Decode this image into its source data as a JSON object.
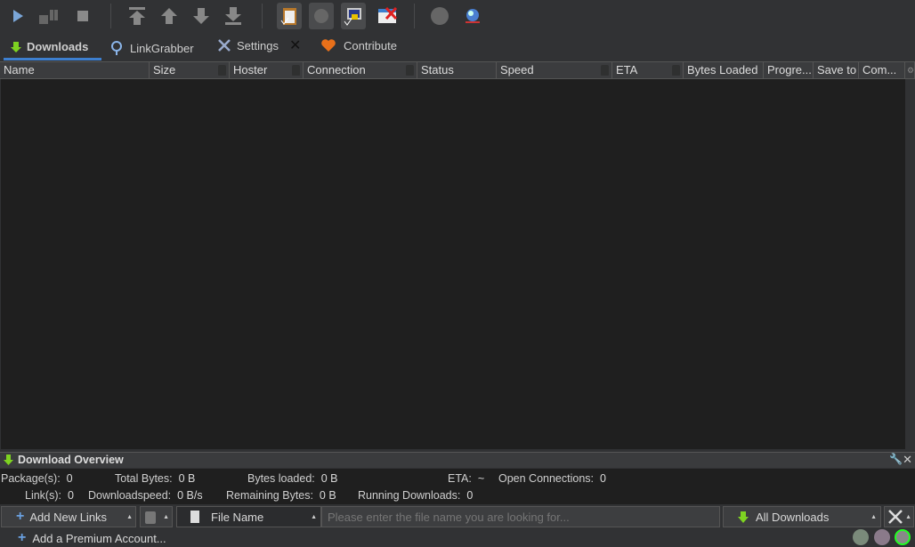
{
  "toolbar": {
    "buttons": [
      "play-icon",
      "pause-icon",
      "stop-icon",
      "move-top-icon",
      "move-up-icon",
      "move-down-icon",
      "move-bottom-icon",
      "clipboard-observer-icon",
      "auto-reconnect-icon",
      "premium-icon",
      "silent-mode-icon",
      "reconnect-icon",
      "update-icon"
    ]
  },
  "tabs": [
    {
      "label": "Downloads",
      "icon": "download-arrow-icon",
      "active": true
    },
    {
      "label": "LinkGrabber",
      "icon": "magnifier-icon"
    },
    {
      "label": "Settings",
      "icon": "tools-icon",
      "closable": true
    },
    {
      "label": "Contribute",
      "icon": "heart-icon"
    }
  ],
  "table": {
    "columns": [
      "Name",
      "Size",
      "Hoster",
      "Connection",
      "Status",
      "Speed",
      "ETA",
      "Bytes Loaded",
      "Progre...",
      "Save to",
      "Com..."
    ]
  },
  "overview": {
    "title": "Download Overview",
    "stats": {
      "packages_label": "Package(s):",
      "packages": "0",
      "total_bytes_label": "Total Bytes:",
      "total_bytes": "0 B",
      "bytes_loaded_label": "Bytes loaded:",
      "bytes_loaded": "0 B",
      "eta_label": "ETA:",
      "eta": "~",
      "open_conn_label": "Open Connections:",
      "open_conn": "0",
      "links_label": "Link(s):",
      "links": "0",
      "speed_label": "Downloadspeed:",
      "speed": "0 B/s",
      "remaining_label": "Remaining Bytes:",
      "remaining": "0 B",
      "running_label": "Running Downloads:",
      "running": "0"
    }
  },
  "bottom": {
    "add_links": "Add New Links",
    "search_field": "File Name",
    "search_placeholder": "Please enter the file name you are looking for...",
    "filter": "All Downloads",
    "premium": "Add a Premium Account..."
  },
  "colors": {
    "accent": "#3d7fcf",
    "green": "#7ed321"
  }
}
